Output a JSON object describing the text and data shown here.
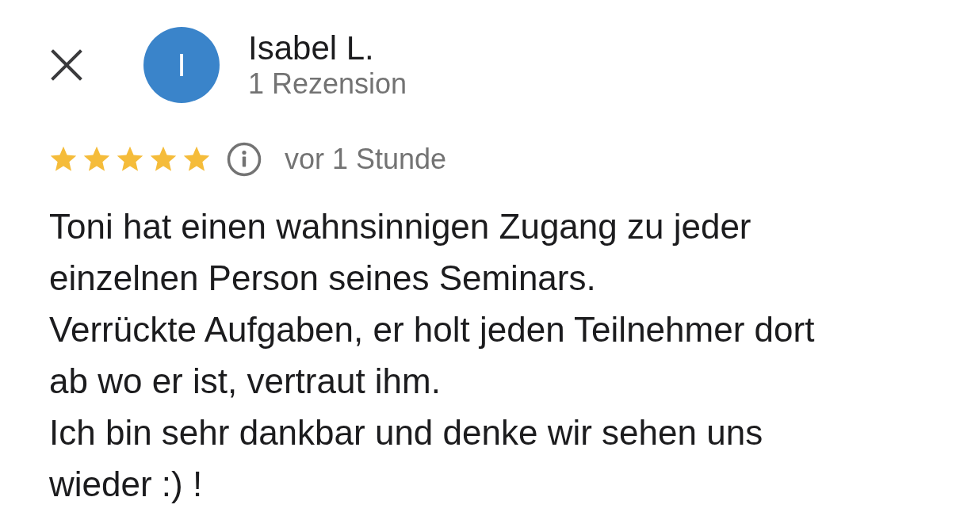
{
  "reviewer": {
    "initial": "I",
    "name": "Isabel L.",
    "review_count": "1 Rezension"
  },
  "review": {
    "stars": 5,
    "time": "vor 1 Stunde",
    "text": "Toni hat einen wahnsinnigen Zugang zu jeder einzelnen Person seines Seminars.\nVerrückte Aufgaben, er holt jeden Teilnehmer dort ab wo er ist, vertraut ihm.\nIch bin sehr dankbar und denke wir sehen uns wieder :) !"
  }
}
